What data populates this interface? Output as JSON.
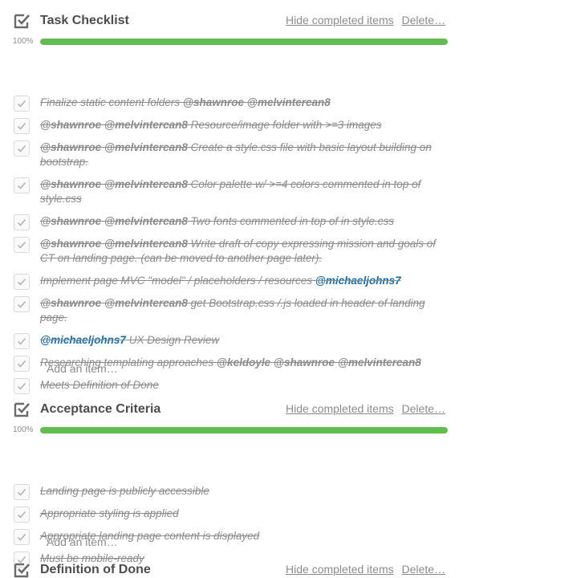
{
  "common": {
    "hide_label": "Hide completed items",
    "delete_label": "Delete…",
    "add_label": "Add an item…"
  },
  "checklists": [
    {
      "title": "Task Checklist",
      "progress_text": "100%",
      "progress": 1.0,
      "items": [
        {
          "segments": [
            {
              "t": "Finalize static content folders "
            },
            {
              "t": "@shawnroe",
              "m": 1
            },
            {
              "t": " "
            },
            {
              "t": "@melvintercan8",
              "m": 1
            }
          ]
        },
        {
          "segments": [
            {
              "t": "@shawnroe",
              "m": 1
            },
            {
              "t": " "
            },
            {
              "t": "@melvintercan8",
              "m": 1
            },
            {
              "t": " Resource/image folder with >=3 images"
            }
          ]
        },
        {
          "segments": [
            {
              "t": "@shawnroe",
              "m": 1
            },
            {
              "t": " "
            },
            {
              "t": "@melvintercan8",
              "m": 1
            },
            {
              "t": " Create a style.css file with basic layout building on bootstrap."
            }
          ]
        },
        {
          "segments": [
            {
              "t": "@shawnroe",
              "m": 1
            },
            {
              "t": " "
            },
            {
              "t": "@melvintercan8",
              "m": 1
            },
            {
              "t": " Color palette w/ >=4 colors commented in top of style.css"
            }
          ]
        },
        {
          "segments": [
            {
              "t": "@shawnroe",
              "m": 1
            },
            {
              "t": " "
            },
            {
              "t": "@melvintercan8",
              "m": 1
            },
            {
              "t": " Two fonts commented in top of in style.css"
            }
          ]
        },
        {
          "segments": [
            {
              "t": "@shawnroe",
              "m": 1
            },
            {
              "t": " "
            },
            {
              "t": "@melvintercan8",
              "m": 1
            },
            {
              "t": " Write draft of copy expressing mission and goals of CT on landing page. (can be moved to another page later)."
            }
          ]
        },
        {
          "segments": [
            {
              "t": "Implement page MVC \"model\" / placeholders / resources "
            },
            {
              "t": "@michaeljohns7",
              "m": 2
            }
          ]
        },
        {
          "segments": [
            {
              "t": "@shawnroe",
              "m": 1
            },
            {
              "t": " "
            },
            {
              "t": "@melvintercan8",
              "m": 1
            },
            {
              "t": " get Bootstrap.css /.js loaded in header of landing page."
            }
          ]
        },
        {
          "segments": [
            {
              "t": "@michaeljohns7",
              "m": 2
            },
            {
              "t": " UX Design Review"
            }
          ]
        },
        {
          "segments": [
            {
              "t": "Researching templating approaches "
            },
            {
              "t": "@keldoyle",
              "m": 1
            },
            {
              "t": " "
            },
            {
              "t": "@shawnroe",
              "m": 1
            },
            {
              "t": " "
            },
            {
              "t": "@melvintercan8",
              "m": 1
            }
          ]
        },
        {
          "segments": [
            {
              "t": "Meets Definition of Done"
            }
          ]
        }
      ]
    },
    {
      "title": "Acceptance Criteria",
      "progress_text": "100%",
      "progress": 1.0,
      "items": [
        {
          "segments": [
            {
              "t": "Landing page is publicly accessible"
            }
          ]
        },
        {
          "segments": [
            {
              "t": "Appropriate styling is applied"
            }
          ]
        },
        {
          "segments": [
            {
              "t": "Appropriate landing page content is displayed"
            }
          ]
        },
        {
          "segments": [
            {
              "t": "Must be mobile-ready"
            }
          ]
        }
      ]
    },
    {
      "title": "Definition of Done",
      "progress_text": "",
      "progress": 0,
      "items": []
    }
  ]
}
